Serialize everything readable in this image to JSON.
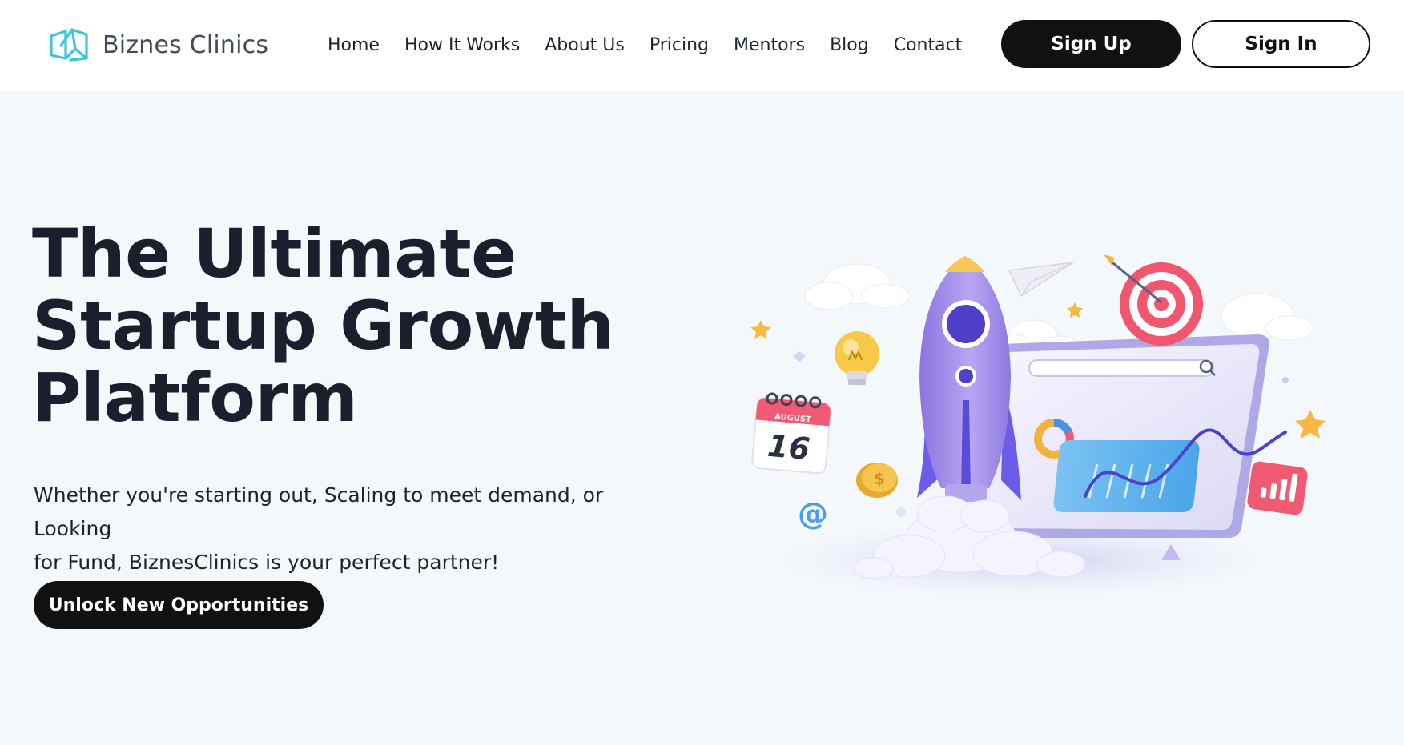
{
  "brand": {
    "name": "Biznes Clinics"
  },
  "nav": {
    "items": [
      {
        "label": "Home"
      },
      {
        "label": "How It Works"
      },
      {
        "label": "About Us"
      },
      {
        "label": "Pricing"
      },
      {
        "label": "Mentors"
      },
      {
        "label": "Blog"
      },
      {
        "label": "Contact"
      }
    ]
  },
  "auth": {
    "signup_label": "Sign Up",
    "signin_label": "Sign In"
  },
  "hero": {
    "title_lines": [
      "The Ultimate",
      "Startup Growth",
      "Platform"
    ],
    "description_line1": "Whether you're starting out, Scaling to meet demand, or Looking",
    "description_line2": "for Fund, BiznesClinics is your perfect partner!",
    "cta_label": "Unlock New Opportunities"
  },
  "illustration": {
    "calendar_month": "AUGUST",
    "calendar_day": "16",
    "at_symbol": "@",
    "coin_symbol": "$"
  },
  "colors": {
    "brand_accent": "#3ec3df",
    "dark": "#111111",
    "background": "#f5f8fb",
    "rocket_purple": "#9c84e6",
    "target_red": "#f0566e"
  }
}
